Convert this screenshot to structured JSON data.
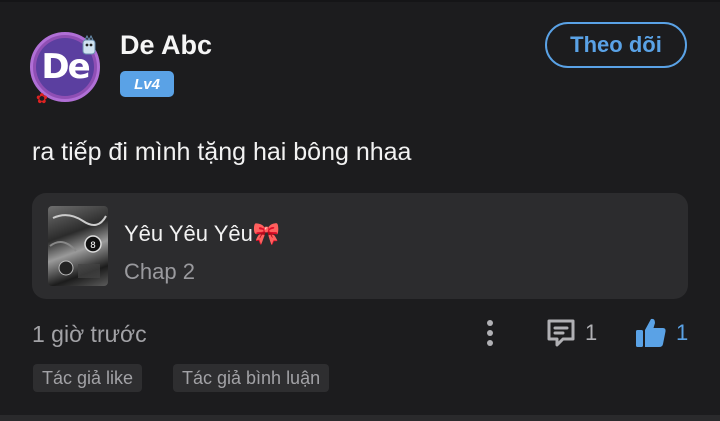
{
  "user": {
    "avatar_initials": "De",
    "name": "De Abc",
    "level": "Lv4"
  },
  "follow_label": "Theo dõi",
  "comment": {
    "text": "ra tiếp đi mình tặng hai bông nhaa",
    "time": "1 giờ trước"
  },
  "story": {
    "title": "Yêu Yêu Yêu🎀",
    "chapter": "Chap 2"
  },
  "actions": {
    "reply_count": "1",
    "like_count": "1"
  },
  "tags": [
    "Tác giả like",
    "Tác giả bình luận"
  ],
  "colors": {
    "accent": "#5aa2e6",
    "background": "#1c1c1e",
    "card": "#2c2c2e",
    "avatar": "#8f4fb4"
  },
  "icons": [
    "more-vertical-icon",
    "comment-icon",
    "thumbs-up-icon"
  ]
}
